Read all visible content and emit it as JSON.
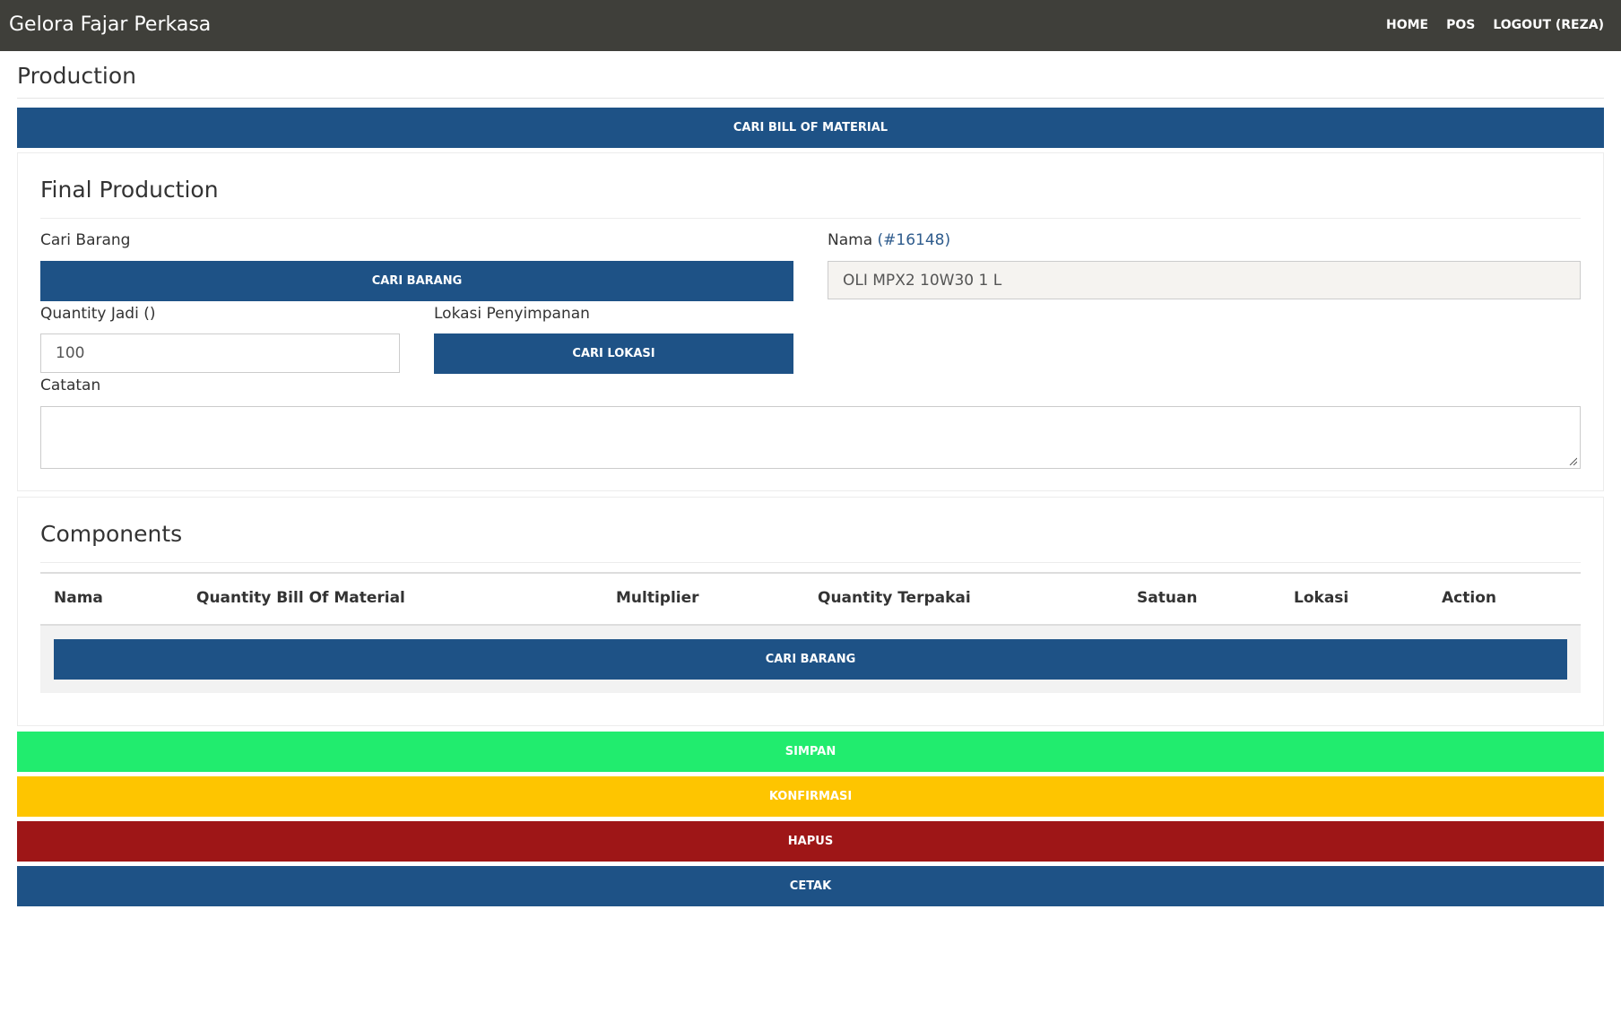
{
  "app": {
    "brand": "Gelora Fajar Perkasa",
    "nav": [
      "HOME",
      "POS",
      "LOGOUT (REZA)"
    ]
  },
  "page": {
    "title": "Production",
    "search_bom_button": "CARI BILL OF MATERIAL"
  },
  "final_production": {
    "title": "Final Production",
    "cari_barang_label": "Cari Barang",
    "cari_barang_button": "CARI BARANG",
    "nama_label": "Nama",
    "nama_id": "(#16148)",
    "nama_value": "OLI MPX2 10W30 1 L",
    "quantity_label": "Quantity Jadi ()",
    "quantity_value": "100",
    "lokasi_label": "Lokasi Penyimpanan",
    "lokasi_button": "CARI LOKASI",
    "catatan_label": "Catatan",
    "catatan_value": ""
  },
  "components": {
    "title": "Components",
    "columns": [
      "Nama",
      "Quantity Bill Of Material",
      "Multiplier",
      "Quantity Terpakai",
      "Satuan",
      "Lokasi",
      "Action"
    ],
    "cari_barang_button": "CARI BARANG"
  },
  "actions": {
    "simpan": "SIMPAN",
    "konfirmasi": "KONFIRMASI",
    "hapus": "HAPUS",
    "cetak": "CETAK"
  },
  "colors": {
    "navbar": "#3f3f3a",
    "primary": "#1e5286",
    "success": "#21ec6e",
    "warning": "#fec500",
    "danger": "#9e1617"
  }
}
